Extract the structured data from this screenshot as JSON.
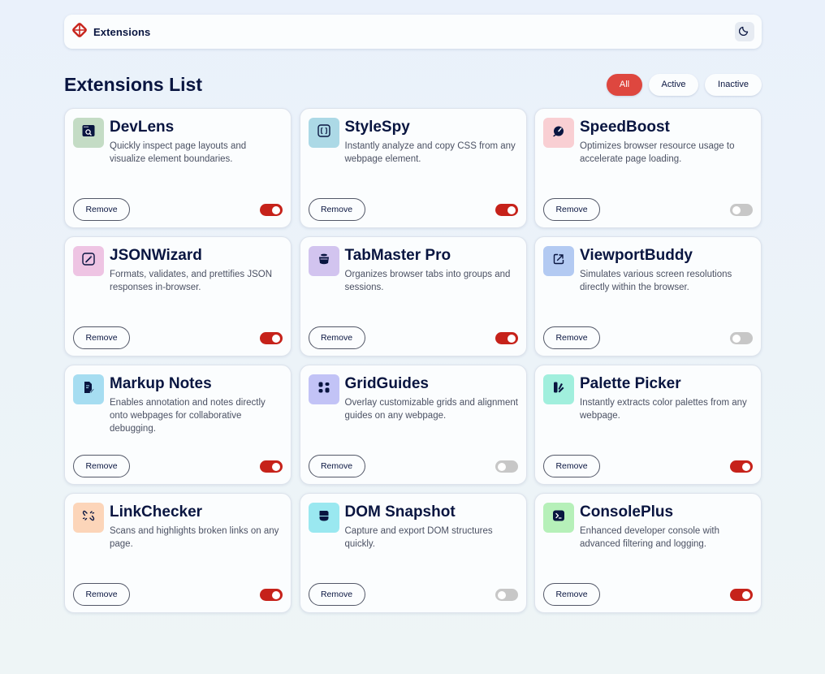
{
  "header": {
    "brand": "Extensions",
    "theme_icon": "moon-icon"
  },
  "page_title": "Extensions List",
  "filters": [
    {
      "label": "All",
      "active": true
    },
    {
      "label": "Active",
      "active": false
    },
    {
      "label": "Inactive",
      "active": false
    }
  ],
  "colors": {
    "accent": "#de473f",
    "toggle_on": "#c6221a",
    "toggle_off": "#c7c7c7",
    "text": "#091540"
  },
  "remove_label": "Remove",
  "extensions": [
    {
      "name": "DevLens",
      "description": "Quickly inspect page layouts and visualize element boundaries.",
      "enabled": true,
      "icon": "browser-search-icon",
      "icon_bg": "#c4dcc5"
    },
    {
      "name": "StyleSpy",
      "description": "Instantly analyze and copy CSS from any webpage element.",
      "enabled": true,
      "icon": "css-braces-icon",
      "icon_bg": "#acd9e6"
    },
    {
      "name": "SpeedBoost",
      "description": "Optimizes browser resource usage to accelerate page loading.",
      "enabled": false,
      "icon": "speed-gauge-icon",
      "icon_bg": "#f9cfd3"
    },
    {
      "name": "JSONWizard",
      "description": "Formats, validates, and prettifies JSON responses in-browser.",
      "enabled": true,
      "icon": "magic-wand-icon",
      "icon_bg": "#eec4e3"
    },
    {
      "name": "TabMaster Pro",
      "description": "Organizes browser tabs into groups and sessions.",
      "enabled": true,
      "icon": "stacked-tabs-icon",
      "icon_bg": "#d2c4ef"
    },
    {
      "name": "ViewportBuddy",
      "description": "Simulates various screen resolutions directly within the browser.",
      "enabled": false,
      "icon": "resize-arrow-icon",
      "icon_bg": "#b3caf2"
    },
    {
      "name": "Markup Notes",
      "description": "Enables annotation and notes directly onto webpages for collaborative debugging.",
      "enabled": true,
      "icon": "note-pen-icon",
      "icon_bg": "#a6ddf1"
    },
    {
      "name": "GridGuides",
      "description": "Overlay customizable grids and alignment guides on any webpage.",
      "enabled": false,
      "icon": "grid-icon",
      "icon_bg": "#c2c3f6"
    },
    {
      "name": "Palette Picker",
      "description": "Instantly extracts color palettes from any webpage.",
      "enabled": true,
      "icon": "palette-icon",
      "icon_bg": "#a1efdd"
    },
    {
      "name": "LinkChecker",
      "description": "Scans and highlights broken links on any page.",
      "enabled": true,
      "icon": "broken-link-icon",
      "icon_bg": "#fcd5b9"
    },
    {
      "name": "DOM Snapshot",
      "description": "Capture and export DOM structures quickly.",
      "enabled": false,
      "icon": "snapshot-icon",
      "icon_bg": "#9ae8f0"
    },
    {
      "name": "ConsolePlus",
      "description": "Enhanced developer console with advanced filtering and logging.",
      "enabled": true,
      "icon": "terminal-icon",
      "icon_bg": "#b6f0b9"
    }
  ]
}
